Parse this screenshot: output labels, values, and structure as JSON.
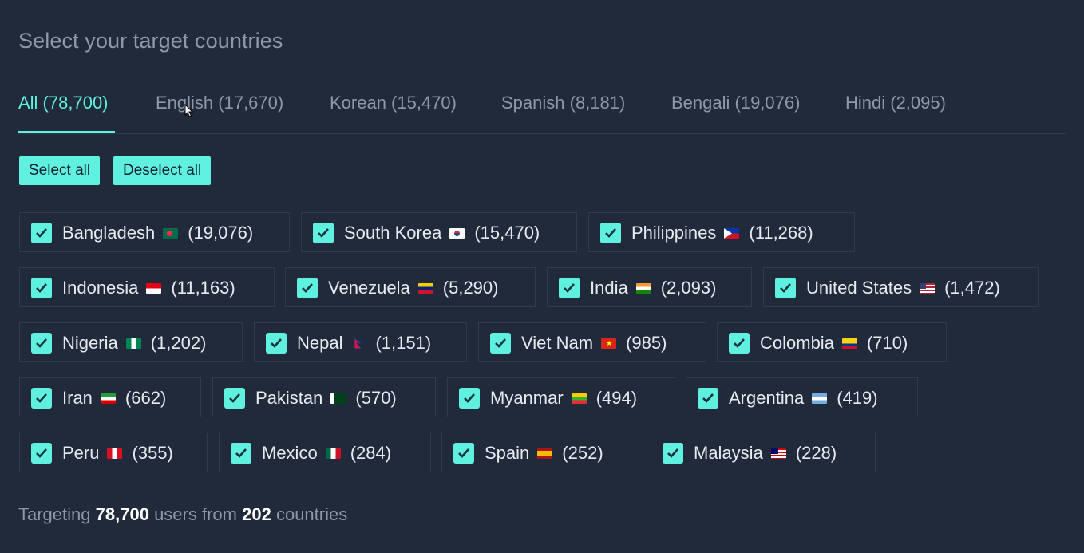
{
  "title": "Select your target countries",
  "tabs": [
    {
      "label": "All (78,700)",
      "active": true
    },
    {
      "label": "English (17,670)"
    },
    {
      "label": "Korean (15,470)"
    },
    {
      "label": "Spanish (8,181)"
    },
    {
      "label": "Bengali (19,076)"
    },
    {
      "label": "Hindi (2,095)"
    }
  ],
  "buttons": {
    "select_all": "Select all",
    "deselect_all": "Deselect all"
  },
  "countries": [
    {
      "name": "Bangladesh",
      "count": "(19,076)",
      "checked": true,
      "flag": "bangladesh-flag-icon"
    },
    {
      "name": "South Korea",
      "count": "(15,470)",
      "checked": true,
      "flag": "south-korea-flag-icon"
    },
    {
      "name": "Philippines",
      "count": "(11,268)",
      "checked": true,
      "flag": "philippines-flag-icon"
    },
    {
      "name": "Indonesia",
      "count": "(11,163)",
      "checked": true,
      "flag": "indonesia-flag-icon"
    },
    {
      "name": "Venezuela",
      "count": "(5,290)",
      "checked": true,
      "flag": "venezuela-flag-icon"
    },
    {
      "name": "India",
      "count": "(2,093)",
      "checked": true,
      "flag": "india-flag-icon"
    },
    {
      "name": "United States",
      "count": "(1,472)",
      "checked": true,
      "flag": "united-states-flag-icon"
    },
    {
      "name": "Nigeria",
      "count": "(1,202)",
      "checked": true,
      "flag": "nigeria-flag-icon"
    },
    {
      "name": "Nepal",
      "count": "(1,151)",
      "checked": true,
      "flag": "nepal-flag-icon"
    },
    {
      "name": "Viet Nam",
      "count": "(985)",
      "checked": true,
      "flag": "vietnam-flag-icon"
    },
    {
      "name": "Colombia",
      "count": "(710)",
      "checked": true,
      "flag": "colombia-flag-icon"
    },
    {
      "name": "Iran",
      "count": "(662)",
      "checked": true,
      "flag": "iran-flag-icon"
    },
    {
      "name": "Pakistan",
      "count": "(570)",
      "checked": true,
      "flag": "pakistan-flag-icon"
    },
    {
      "name": "Myanmar",
      "count": "(494)",
      "checked": true,
      "flag": "myanmar-flag-icon"
    },
    {
      "name": "Argentina",
      "count": "(419)",
      "checked": true,
      "flag": "argentina-flag-icon"
    },
    {
      "name": "Peru",
      "count": "(355)",
      "checked": true,
      "flag": "peru-flag-icon"
    },
    {
      "name": "Mexico",
      "count": "(284)",
      "checked": true,
      "flag": "mexico-flag-icon"
    },
    {
      "name": "Spain",
      "count": "(252)",
      "checked": true,
      "flag": "spain-flag-icon"
    },
    {
      "name": "Malaysia",
      "count": "(228)",
      "checked": true,
      "flag": "malaysia-flag-icon"
    }
  ],
  "summary": {
    "prefix": "Targeting",
    "users": "78,700",
    "middle": "users from",
    "countries": "202",
    "suffix": "countries"
  },
  "colors": {
    "accent": "#5ff0e0",
    "background": "#212a3b",
    "muted_text": "#8f98a6"
  }
}
